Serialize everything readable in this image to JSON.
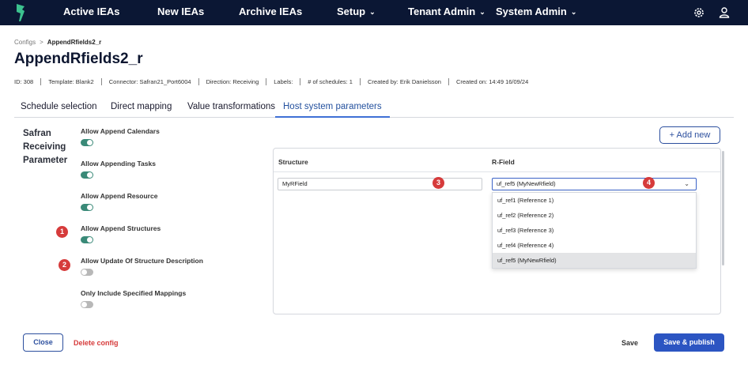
{
  "nav": {
    "logo_icon": "brand-logo-icon",
    "items": [
      {
        "label": "Active IEAs"
      },
      {
        "label": "New IEAs"
      },
      {
        "label": "Archive IEAs"
      },
      {
        "label": "Setup"
      },
      {
        "label": "Tenant Admin"
      },
      {
        "label": "System Admin"
      }
    ],
    "settings_icon": "gear-icon",
    "user_icon": "user-icon"
  },
  "breadcrumb": {
    "root": "Configs",
    "separator": ">",
    "current": "AppendRfields2_r"
  },
  "page_title": "AppendRfields2_r",
  "meta": {
    "id": "ID: 308",
    "template": "Template:   Blank2",
    "connector": "Connector:   Safran21_Port6004",
    "direction": "Direction:   Receiving",
    "labels": "Labels:",
    "schedules": "# of schedules: 1",
    "created_by": "Created by: Erik Danielsson",
    "created_on": "Created on: 14:49 16/09/24"
  },
  "tabs": [
    {
      "label": "Schedule selection",
      "active": false
    },
    {
      "label": "Direct mapping",
      "active": false
    },
    {
      "label": "Value transformations",
      "active": false
    },
    {
      "label": "Host system parameters",
      "active": true
    }
  ],
  "section_label": "Safran Receiving Parameter",
  "options": [
    {
      "label": "Allow Append Calendars",
      "enabled": true
    },
    {
      "label": "Allow Appending Tasks",
      "enabled": true
    },
    {
      "label": "Allow Append Resource",
      "enabled": true
    },
    {
      "label": "Allow Append Structures",
      "enabled": true
    },
    {
      "label": "Allow Update Of Structure Description",
      "enabled": false
    },
    {
      "label": "Only Include Specified Mappings",
      "enabled": false
    }
  ],
  "markers": [
    "1",
    "2",
    "3",
    "4"
  ],
  "add_button": "+ Add new",
  "table": {
    "col_structure": "Structure",
    "col_rfield": "R-Field",
    "structure_value": "MyRField",
    "rfield_value": "uf_ref5 (MyNewRfield)",
    "dropdown_options": [
      "uf_ref1 (Reference 1)",
      "uf_ref2 (Reference 2)",
      "uf_ref3 (Reference 3)",
      "uf_ref4 (Reference 4)",
      "uf_ref5 (MyNewRfield)"
    ],
    "selected_option": "uf_ref5 (MyNewRfield)"
  },
  "footer": {
    "close": "Close",
    "delete": "Delete config",
    "save": "Save",
    "publish": "Save & publish"
  },
  "colors": {
    "nav_bg": "#0b1734",
    "accent": "#2c55c2",
    "toggle_on": "#3a8a78",
    "danger": "#d63b3b"
  }
}
